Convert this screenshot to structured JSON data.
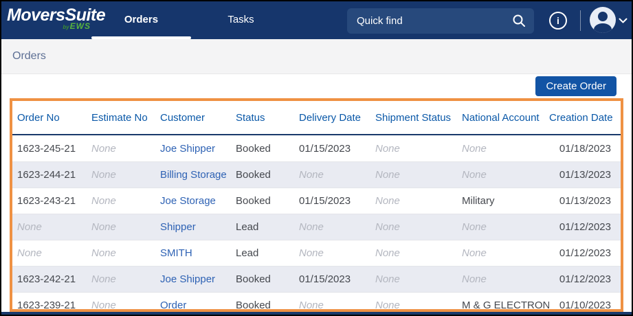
{
  "brand": {
    "name": "MoversSuite",
    "byline_by": "by",
    "byline_ews": "EWS"
  },
  "nav": {
    "tabs": [
      {
        "label": "Orders",
        "active": true
      },
      {
        "label": "Tasks",
        "active": false
      }
    ],
    "search": {
      "placeholder": "Quick find",
      "icon": "search-icon"
    },
    "info_glyph": "i",
    "icons": [
      "search-icon",
      "info-icon",
      "user-avatar-icon",
      "chevron-down-icon"
    ]
  },
  "breadcrumb": {
    "title": "Orders"
  },
  "toolbar": {
    "create_order_label": "Create Order"
  },
  "table": {
    "columns": [
      "Order No",
      "Estimate No",
      "Customer",
      "Status",
      "Delivery Date",
      "Shipment Status",
      "National Account",
      "Creation Date"
    ],
    "rows": [
      {
        "order_no": "1623-245-21",
        "estimate_no": "None",
        "customer": "Joe Shipper",
        "status": "Booked",
        "delivery_date": "01/15/2023",
        "shipment_status": "None",
        "national_account": "None",
        "creation_date": "01/18/2023"
      },
      {
        "order_no": "1623-244-21",
        "estimate_no": "None",
        "customer": "Billing Storage",
        "status": "Booked",
        "delivery_date": "None",
        "shipment_status": "None",
        "national_account": "None",
        "creation_date": "01/13/2023"
      },
      {
        "order_no": "1623-243-21",
        "estimate_no": "None",
        "customer": "Joe Storage",
        "status": "Booked",
        "delivery_date": "01/15/2023",
        "shipment_status": "None",
        "national_account": "Military",
        "creation_date": "01/13/2023"
      },
      {
        "order_no": "None",
        "estimate_no": "None",
        "customer": "Shipper",
        "status": "Lead",
        "delivery_date": "None",
        "shipment_status": "None",
        "national_account": "None",
        "creation_date": "01/12/2023"
      },
      {
        "order_no": "None",
        "estimate_no": "None",
        "customer": "SMITH",
        "status": "Lead",
        "delivery_date": "None",
        "shipment_status": "None",
        "national_account": "None",
        "creation_date": "01/12/2023"
      },
      {
        "order_no": "1623-242-21",
        "estimate_no": "None",
        "customer": "Joe Shipper",
        "status": "Booked",
        "delivery_date": "01/15/2023",
        "shipment_status": "None",
        "national_account": "None",
        "creation_date": "01/12/2023"
      },
      {
        "order_no": "1623-239-21",
        "estimate_no": "None",
        "customer": "Order",
        "status": "Booked",
        "delivery_date": "None",
        "shipment_status": "None",
        "national_account": "M & G ELECTRONICS",
        "creation_date": "01/10/2023"
      }
    ],
    "row_keys": [
      "order_no",
      "estimate_no",
      "customer",
      "status",
      "delivery_date",
      "shipment_status",
      "national_account",
      "creation_date"
    ]
  },
  "colors": {
    "nav_bg": "#16366C",
    "accent_orange": "#EF9143",
    "button_blue": "#1254A5",
    "header_blue": "#0A58A8",
    "link_blue": "#2E62B4",
    "brand_green": "#57B33E",
    "alt_row_bg": "#E9EBF2",
    "header_rule": "#19396B"
  }
}
